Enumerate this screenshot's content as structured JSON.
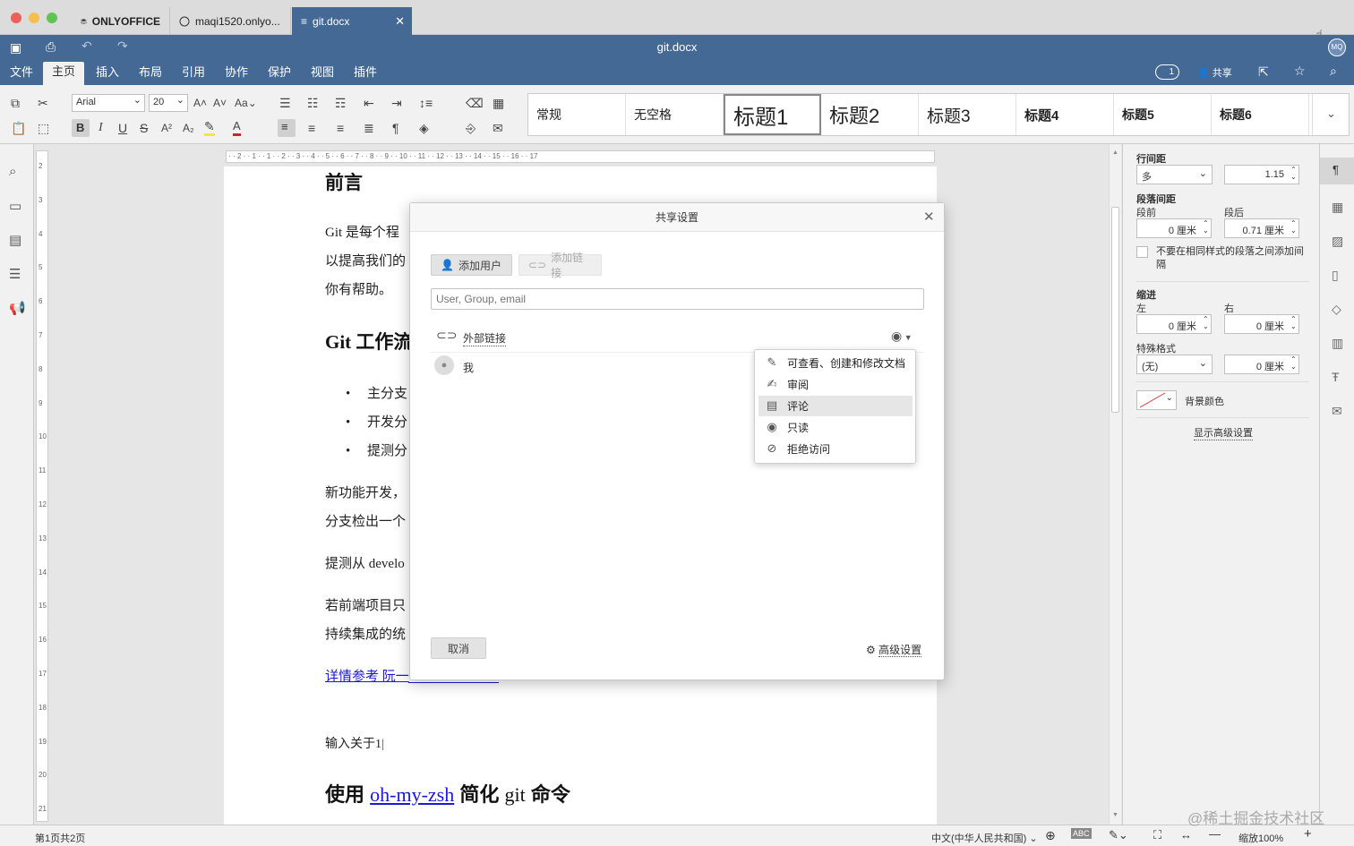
{
  "tabs": [
    {
      "label": "ONLYOFFICE"
    },
    {
      "label": "maqi1520.onlyo..."
    },
    {
      "label": "git.docx"
    }
  ],
  "window_title": "git.docx",
  "user_avatar": "MQ",
  "menu": [
    "文件",
    "主页",
    "插入",
    "布局",
    "引用",
    "协作",
    "保护",
    "视图",
    "插件"
  ],
  "header_right": {
    "users_count": "1",
    "share": "共享"
  },
  "toolbar": {
    "font_name": "Arial",
    "font_size": "20",
    "case": "Aa",
    "bold": "B",
    "italic": "I",
    "underline": "U",
    "strike": "S",
    "superscript": "A²",
    "subscript": "A₂",
    "font_color": "A"
  },
  "styles": [
    "常规",
    "无空格",
    "标题1",
    "标题2",
    "标题3",
    "标题4",
    "标题5",
    "标题6"
  ],
  "ruler": [
    "2",
    "1",
    "1",
    "2",
    "3",
    "4",
    "5",
    "6",
    "7",
    "8",
    "9",
    "10",
    "11",
    "12",
    "13",
    "14",
    "15",
    "16",
    "17"
  ],
  "document": {
    "heading1": "前言",
    "p1": [
      "Git 是每个程",
      "以提高我们的",
      "你有帮助。"
    ],
    "heading2": "Git 工作流",
    "bullets": [
      "主分支",
      "开发分",
      "提测分"
    ],
    "p2": [
      "新功能开发，",
      "分支检出一个"
    ],
    "p3": "提测从 develo",
    "p4": [
      "若前端项目只",
      "持续集成的统"
    ],
    "link": "详情参考 阮一",
    "input_line": "输入关于1",
    "heading3_pre": "使用",
    "heading3_link": "oh-my-zsh",
    "heading3_post1": "简化",
    "heading3_post2": "git",
    "heading3_post3": "命令"
  },
  "dialog": {
    "title": "共享设置",
    "add_user": "添加用户",
    "add_link": "添加链接",
    "search_placeholder": "User, Group, email",
    "external_link": "外部链接",
    "me": "我",
    "cancel": "取消",
    "advanced": "高级设置",
    "permissions": [
      {
        "label": "可查看、创建和修改文档",
        "icon": "pencil-icon"
      },
      {
        "label": "审阅",
        "icon": "review-icon"
      },
      {
        "label": "评论",
        "icon": "comment-icon"
      },
      {
        "label": "只读",
        "icon": "eye-icon"
      },
      {
        "label": "拒绝访问",
        "icon": "eye-off-icon"
      }
    ],
    "highlighted_permission": "评论"
  },
  "right_panel": {
    "line_spacing_label": "行间距",
    "line_spacing_type": "多",
    "line_spacing_value": "1.15",
    "para_spacing_label": "段落间距",
    "before_label": "段前",
    "after_label": "段后",
    "before_value": "0 厘米",
    "after_value": "0.71 厘米",
    "no_space_checkbox": "不要在相同样式的段落之间添加间隔",
    "indent_label": "缩进",
    "left_label": "左",
    "right_label": "右",
    "left_value": "0 厘米",
    "right_value": "0 厘米",
    "special_label": "特殊格式",
    "special_value": "(无)",
    "special_amount": "0 厘米",
    "bg_color": "背景颜色",
    "advanced_link": "显示高级设置"
  },
  "status": {
    "page": "第1页共2页",
    "language": "中文(中华人民共和国)",
    "zoom": "缩放100%",
    "watermark": "@稀土掘金技术社区"
  },
  "colors": {
    "brand": "#446995",
    "link": "#1a1ad6",
    "highlight": "#e6e6e6"
  }
}
